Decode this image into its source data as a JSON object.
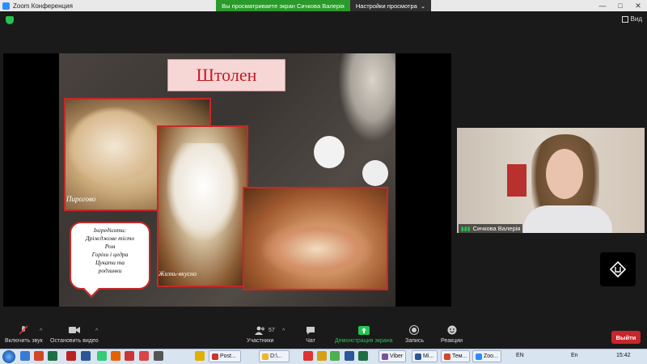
{
  "window": {
    "title": "Zoom Конференция",
    "controls": [
      "—",
      "□",
      "✕"
    ]
  },
  "share_banner": {
    "text": "Вы просматриваете экран Сичкова Валерія",
    "view_settings": "Настройки просмотра",
    "view_settings_caret": "⌄"
  },
  "top": {
    "view_label": "Вид"
  },
  "slide": {
    "title": "Штолен",
    "photo_caption": "Пирогово",
    "watermark": "Жизнь-вкусно",
    "ingredients": [
      "Інгредієнти:",
      "Дріжджове тісто",
      "Ром",
      "Горіхи і цедра",
      "Цукати та",
      "родзинки"
    ]
  },
  "participant": {
    "name": "Сичкова Валерія"
  },
  "toolbar": {
    "unmute": "Включить звук",
    "stop_video": "Остановить видео",
    "participants": "Участники",
    "participants_count": "57",
    "chat": "Чат",
    "share_screen": "Демонстрация экрана",
    "record": "Запись",
    "reactions": "Реакции",
    "leave": "Выйти",
    "caret": "^"
  },
  "taskbar": {
    "tasks": [
      "Post...",
      "D:\\...",
      "Viber",
      "Mi...",
      "Тем...",
      "Zoo..."
    ],
    "lang_1": "EN",
    "lang_2": "En",
    "clock": "15:42"
  },
  "colors": {
    "share_green": "#2a9a2a",
    "leave_red": "#c7262a",
    "slide_accent_red": "#c62828",
    "title_pink": "#f7d6d6"
  }
}
